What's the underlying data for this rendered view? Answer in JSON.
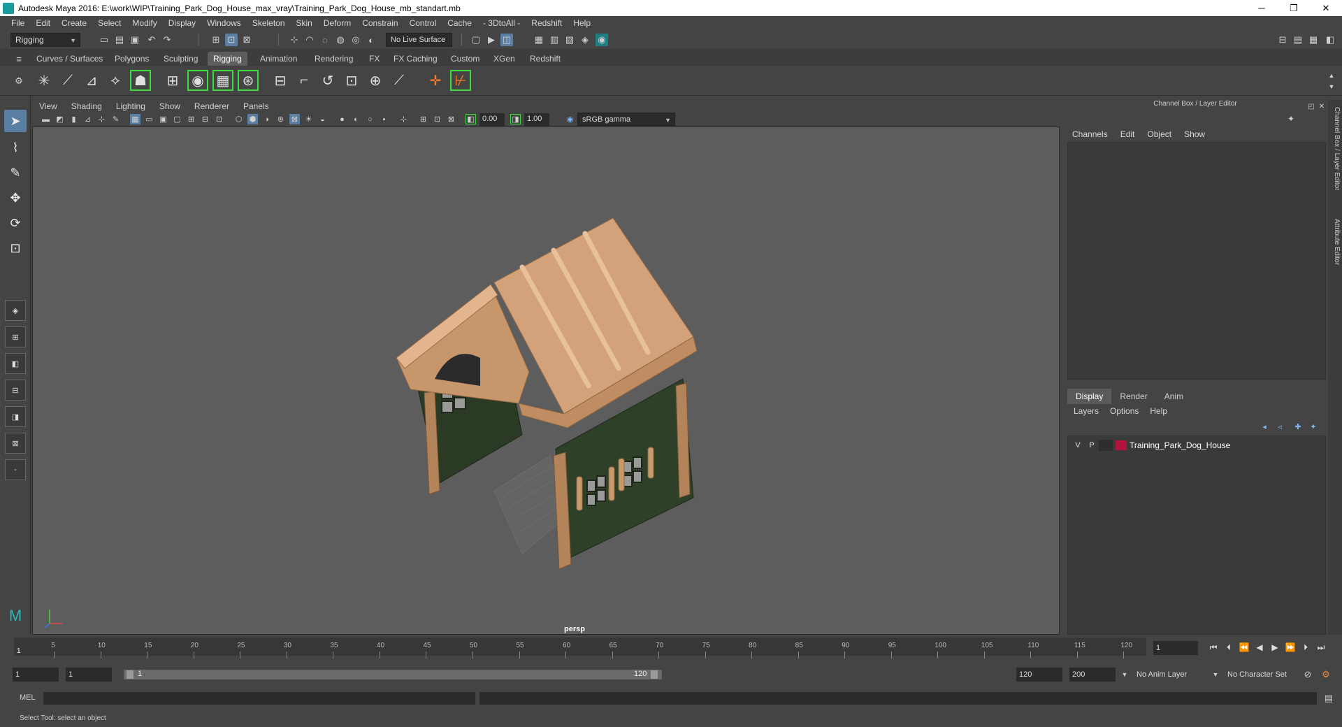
{
  "window": {
    "title": "Autodesk Maya 2016: E:\\work\\WIP\\Training_Park_Dog_House_max_vray\\Training_Park_Dog_House_mb_standart.mb",
    "minimize": "─",
    "restore": "❐",
    "close": "✕"
  },
  "menubar": [
    "File",
    "Edit",
    "Create",
    "Select",
    "Modify",
    "Display",
    "Windows",
    "Skeleton",
    "Skin",
    "Deform",
    "Constrain",
    "Control",
    "Cache",
    "- 3DtoAll -",
    "Redshift",
    "Help"
  ],
  "statusline": {
    "menuset": "Rigging",
    "live_surface": "No Live Surface"
  },
  "shelf_tabs": [
    "Curves / Surfaces",
    "Polygons",
    "Sculpting",
    "Rigging",
    "Animation",
    "Rendering",
    "FX",
    "FX Caching",
    "Custom",
    "XGen",
    "Redshift"
  ],
  "shelf_active": "Rigging",
  "panel": {
    "menus": [
      "View",
      "Shading",
      "Lighting",
      "Show",
      "Renderer",
      "Panels"
    ],
    "exposure": "0.00",
    "gamma": "1.00",
    "colorspace": "sRGB gamma",
    "camera_label": "persp"
  },
  "channel_box": {
    "title": "Channel Box / Layer Editor",
    "menus": [
      "Channels",
      "Edit",
      "Object",
      "Show"
    ]
  },
  "layer_editor": {
    "tabs": [
      "Display",
      "Render",
      "Anim"
    ],
    "active_tab": "Display",
    "menus": [
      "Layers",
      "Options",
      "Help"
    ],
    "layers": [
      {
        "v": "V",
        "p": "P",
        "color": "#b0143c",
        "name": "Training_Park_Dog_House"
      }
    ]
  },
  "side_tabs": [
    "Channel Box / Layer Editor",
    "Attribute Editor"
  ],
  "timeline": {
    "ticks": [
      "5",
      "10",
      "15",
      "20",
      "25",
      "30",
      "35",
      "40",
      "45",
      "50",
      "55",
      "60",
      "65",
      "70",
      "75",
      "80",
      "85",
      "90",
      "95",
      "100",
      "105",
      "110",
      "115",
      "120"
    ],
    "start_label": "1",
    "current_frame": "1"
  },
  "range": {
    "start": "1",
    "playback_start": "1",
    "slider_start": "1",
    "slider_end": "120",
    "playback_end": "120",
    "end": "200",
    "anim_layer": "No Anim Layer",
    "character_set": "No Character Set"
  },
  "command_line": {
    "label": "MEL"
  },
  "help_line": {
    "text": "Select Tool: select an object"
  },
  "colors": {
    "accent": "#5a7fa3",
    "highlight_green": "#3fdc3f",
    "viewport_bg": "#5d5d5d"
  }
}
